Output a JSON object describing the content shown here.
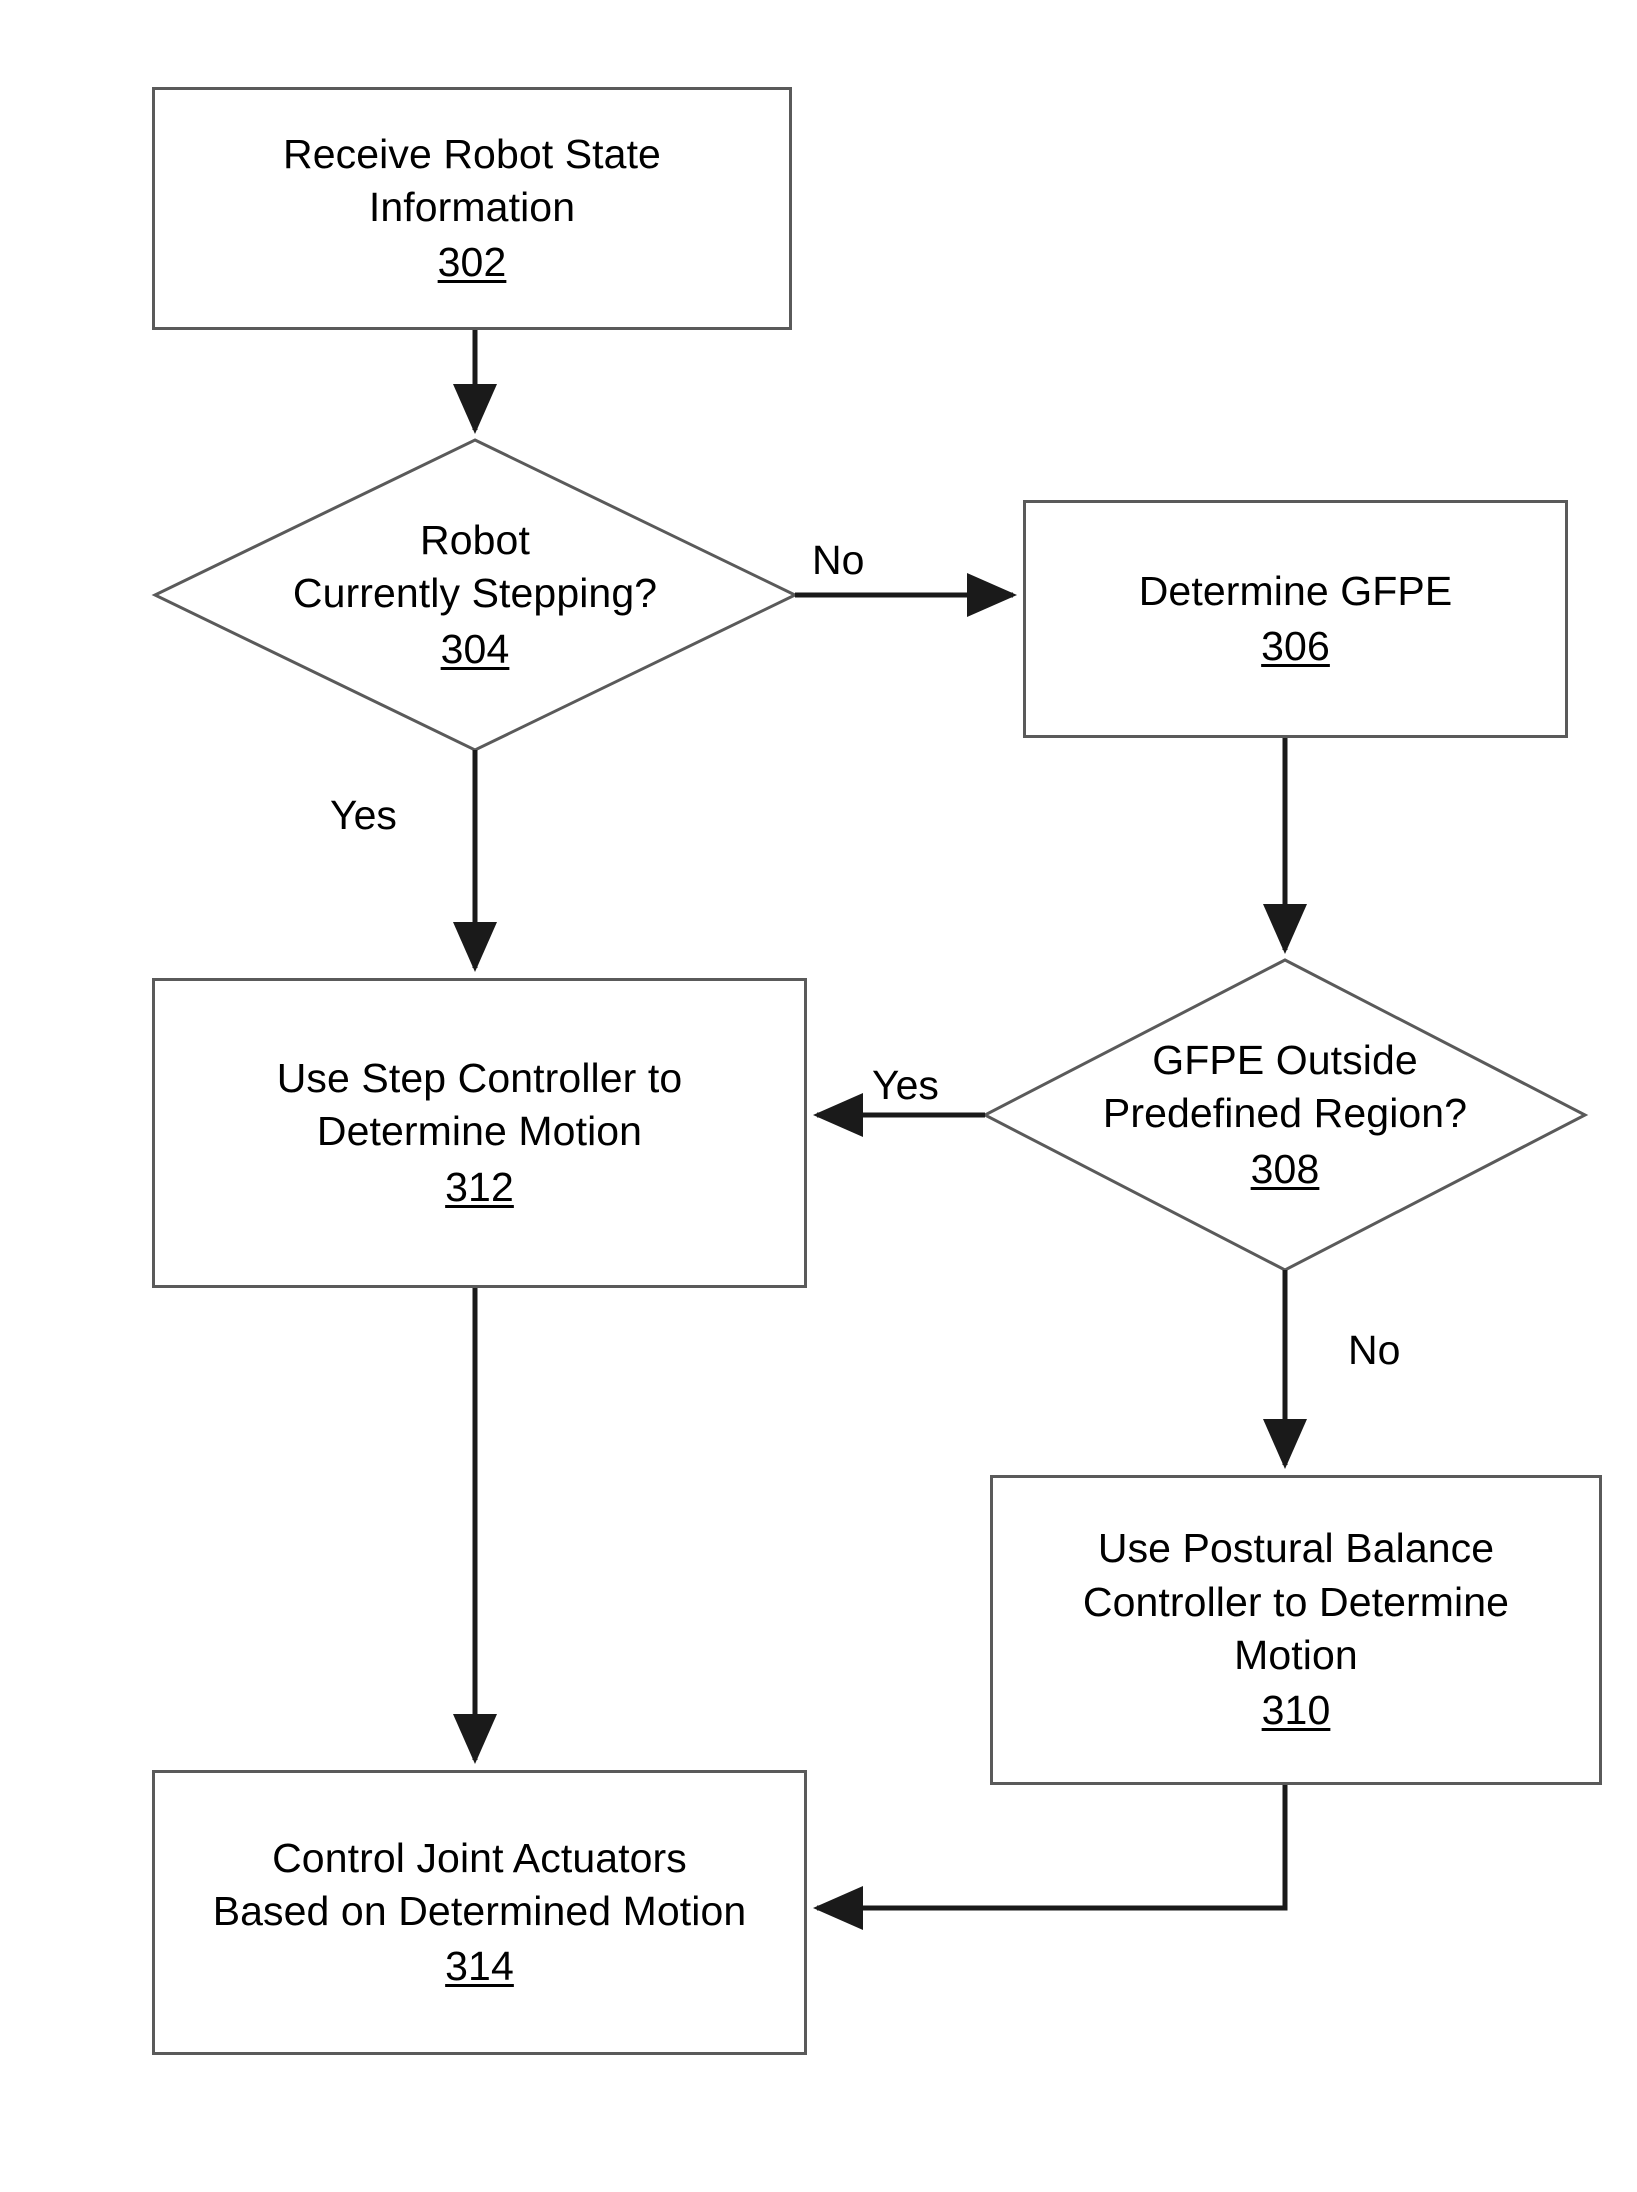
{
  "figure": {
    "type": "flowchart",
    "orientation": "top-to-bottom",
    "background_color": "#ffffff",
    "stroke_color": "#5a5a5a",
    "text_color": "#000000"
  },
  "nodes": [
    {
      "id": "302",
      "shape": "process",
      "lines": [
        "Receive Robot State",
        "Information"
      ],
      "ref": "302"
    },
    {
      "id": "304",
      "shape": "decision",
      "lines": [
        "Robot",
        "Currently Stepping?"
      ],
      "ref": "304"
    },
    {
      "id": "306",
      "shape": "process",
      "lines": [
        "Determine GFPE"
      ],
      "ref": "306"
    },
    {
      "id": "308",
      "shape": "decision",
      "lines": [
        "GFPE Outside",
        "Predefined Region?"
      ],
      "ref": "308"
    },
    {
      "id": "310",
      "shape": "process",
      "lines": [
        "Use Postural Balance",
        "Controller to Determine",
        "Motion"
      ],
      "ref": "310"
    },
    {
      "id": "312",
      "shape": "process",
      "lines": [
        "Use Step Controller to",
        "Determine Motion"
      ],
      "ref": "312"
    },
    {
      "id": "314",
      "shape": "process",
      "lines": [
        "Control Joint Actuators",
        "Based on Determined Motion"
      ],
      "ref": "314"
    }
  ],
  "edges": [
    {
      "from": "302",
      "to": "304",
      "label": ""
    },
    {
      "from": "304",
      "to": "306",
      "label": "No"
    },
    {
      "from": "304",
      "to": "312",
      "label": "Yes"
    },
    {
      "from": "306",
      "to": "308",
      "label": ""
    },
    {
      "from": "308",
      "to": "312",
      "label": "Yes"
    },
    {
      "from": "308",
      "to": "310",
      "label": "No"
    },
    {
      "from": "312",
      "to": "314",
      "label": ""
    },
    {
      "from": "310",
      "to": "314",
      "label": ""
    }
  ],
  "edge_labels": {
    "no_1": "No",
    "yes_1": "Yes",
    "yes_2": "Yes",
    "no_2": "No"
  },
  "node_text": {
    "n302": {
      "l0": "Receive Robot State",
      "l1": "Information",
      "ref": "302"
    },
    "n304": {
      "l0": "Robot",
      "l1": "Currently Stepping?",
      "ref": "304"
    },
    "n306": {
      "l0": "Determine GFPE",
      "ref": "306"
    },
    "n308": {
      "l0": "GFPE Outside",
      "l1": "Predefined Region?",
      "ref": "308"
    },
    "n310": {
      "l0": "Use Postural Balance",
      "l1": "Controller to Determine",
      "l2": "Motion",
      "ref": "310"
    },
    "n312": {
      "l0": "Use Step Controller to",
      "l1": "Determine Motion",
      "ref": "312"
    },
    "n314": {
      "l0": "Control Joint Actuators",
      "l1": "Based on Determined Motion",
      "ref": "314"
    }
  }
}
